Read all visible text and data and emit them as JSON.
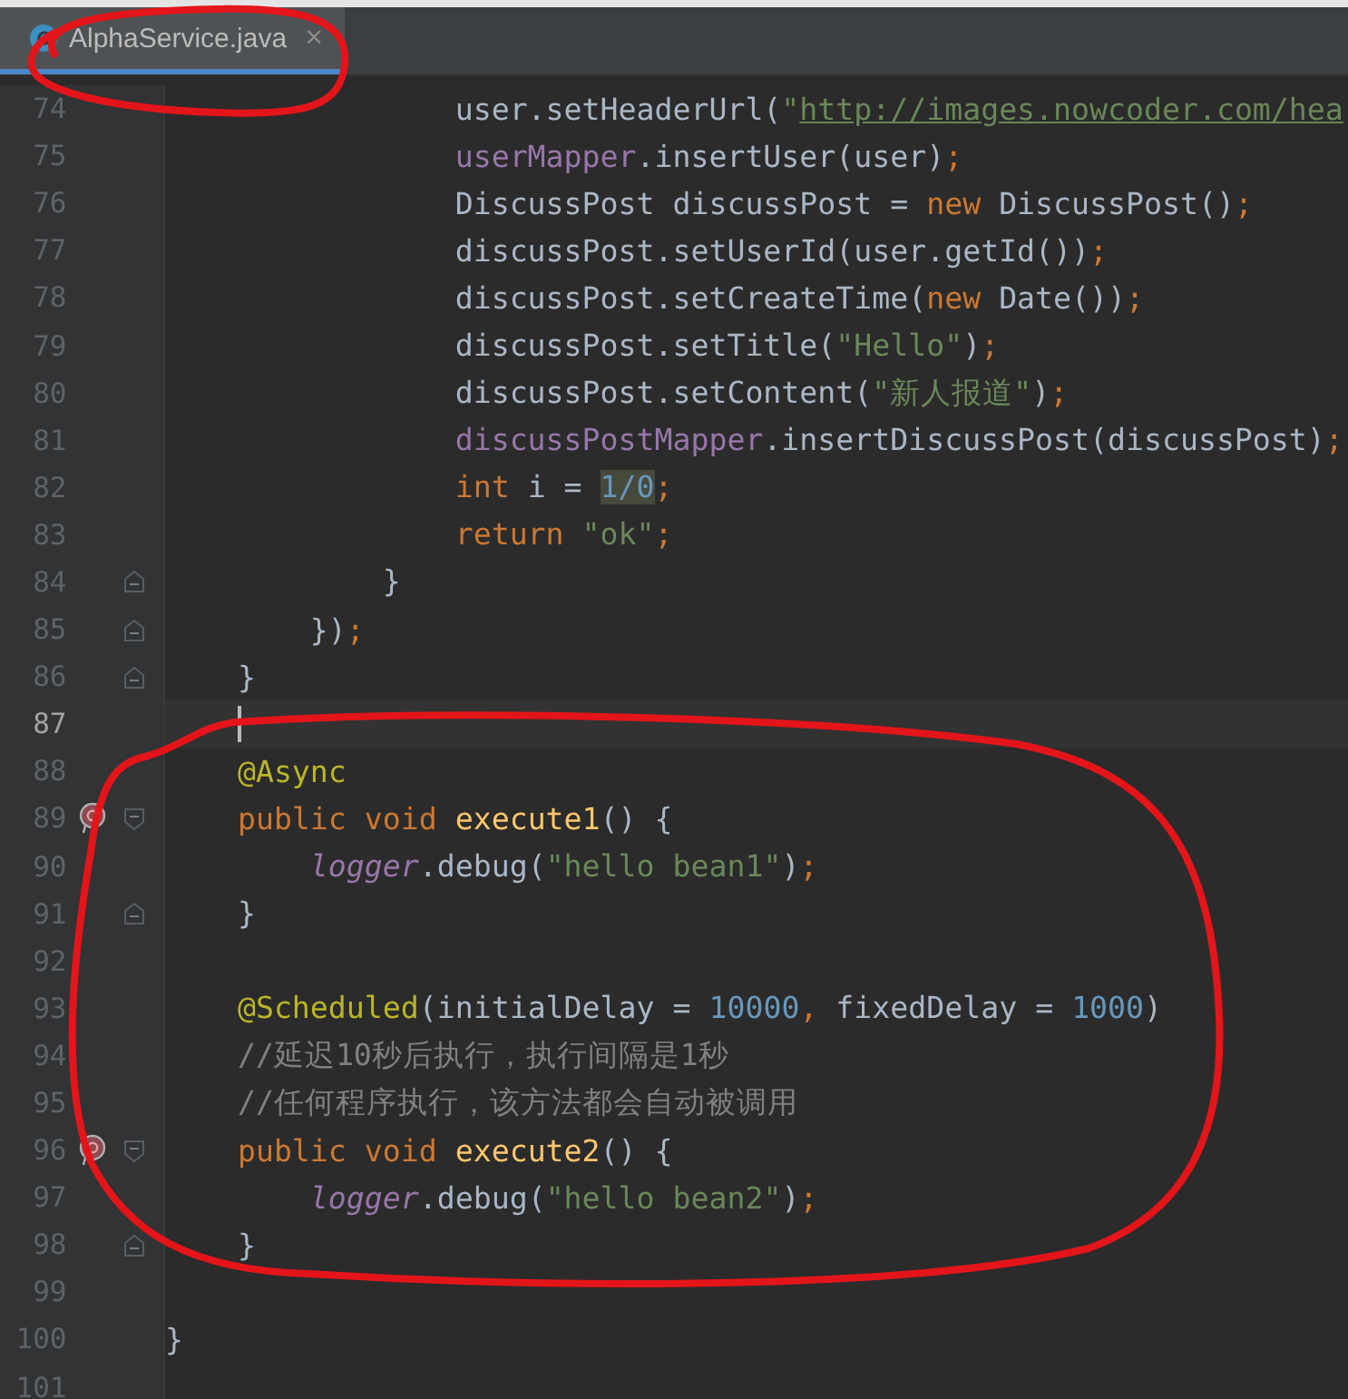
{
  "tab": {
    "label": "AlphaService.java",
    "close": "×",
    "selected": true
  },
  "lines": [
    {
      "number": "74",
      "tokens": [
        {
          "kind": "plain",
          "text": "                user.setHeaderUrl("
        },
        {
          "kind": "string",
          "text": "\""
        },
        {
          "kind": "url",
          "text": "http://images.nowcoder.com/hea"
        }
      ]
    },
    {
      "number": "75",
      "tokens": [
        {
          "kind": "field",
          "text": "                userMapper"
        },
        {
          "kind": "plain",
          "text": ".insertUser(user)"
        },
        {
          "kind": "punct",
          "text": ";"
        }
      ]
    },
    {
      "number": "76",
      "tokens": [
        {
          "kind": "plain",
          "text": "                DiscussPost discussPost = "
        },
        {
          "kind": "keyword",
          "text": "new"
        },
        {
          "kind": "plain",
          "text": " DiscussPost()"
        },
        {
          "kind": "punct",
          "text": ";"
        }
      ]
    },
    {
      "number": "77",
      "tokens": [
        {
          "kind": "plain",
          "text": "                discussPost.setUserId(user.getId())"
        },
        {
          "kind": "punct",
          "text": ";"
        }
      ]
    },
    {
      "number": "78",
      "tokens": [
        {
          "kind": "plain",
          "text": "                discussPost.setCreateTime("
        },
        {
          "kind": "keyword",
          "text": "new"
        },
        {
          "kind": "plain",
          "text": " Date())"
        },
        {
          "kind": "punct",
          "text": ";"
        }
      ]
    },
    {
      "number": "79",
      "tokens": [
        {
          "kind": "plain",
          "text": "                discussPost.setTitle("
        },
        {
          "kind": "string",
          "text": "\"Hello\""
        },
        {
          "kind": "plain",
          "text": ")"
        },
        {
          "kind": "punct",
          "text": ";"
        }
      ]
    },
    {
      "number": "80",
      "tokens": [
        {
          "kind": "plain",
          "text": "                discussPost.setContent("
        },
        {
          "kind": "string",
          "text": "\"新人报道\""
        },
        {
          "kind": "plain",
          "text": ")"
        },
        {
          "kind": "punct",
          "text": ";"
        }
      ]
    },
    {
      "number": "81",
      "tokens": [
        {
          "kind": "field",
          "text": "                discussPostMapper"
        },
        {
          "kind": "plain",
          "text": ".insertDiscussPost(discussPost)"
        },
        {
          "kind": "punct",
          "text": ";"
        }
      ]
    },
    {
      "number": "82",
      "tokens": [
        {
          "kind": "keyword",
          "text": "                int"
        },
        {
          "kind": "plain",
          "text": " i = "
        },
        {
          "kind": "warning",
          "text": "1/0"
        },
        {
          "kind": "punct",
          "text": ";"
        }
      ]
    },
    {
      "number": "83",
      "tokens": [
        {
          "kind": "keyword",
          "text": "                return "
        },
        {
          "kind": "string",
          "text": "\"ok\""
        },
        {
          "kind": "punct",
          "text": ";"
        }
      ]
    },
    {
      "number": "84",
      "fold_end": true,
      "tokens": [
        {
          "kind": "plain",
          "text": "            }"
        }
      ]
    },
    {
      "number": "85",
      "fold_end": true,
      "tokens": [
        {
          "kind": "plain",
          "text": "        })"
        },
        {
          "kind": "punct",
          "text": ";"
        }
      ]
    },
    {
      "number": "86",
      "fold_end": true,
      "tokens": [
        {
          "kind": "plain",
          "text": "    }"
        }
      ]
    },
    {
      "number": "87",
      "current": true,
      "caret": true
    },
    {
      "number": "88",
      "tokens": [
        {
          "kind": "annotation",
          "text": "    @Async"
        }
      ]
    },
    {
      "number": "89",
      "method_marker": true,
      "fold_start": true,
      "tokens": [
        {
          "kind": "keyword",
          "text": "    public void "
        },
        {
          "kind": "method",
          "text": "execute1"
        },
        {
          "kind": "plain",
          "text": "() {"
        }
      ]
    },
    {
      "number": "90",
      "tokens": [
        {
          "kind": "static",
          "text": "        logger"
        },
        {
          "kind": "plain",
          "text": ".debug("
        },
        {
          "kind": "string",
          "text": "\"hello bean1\""
        },
        {
          "kind": "plain",
          "text": ")"
        },
        {
          "kind": "punct",
          "text": ";"
        }
      ]
    },
    {
      "number": "91",
      "fold_end": true,
      "tokens": [
        {
          "kind": "plain",
          "text": "    }"
        }
      ]
    },
    {
      "number": "92"
    },
    {
      "number": "93",
      "tokens": [
        {
          "kind": "annotation",
          "text": "    @Scheduled"
        },
        {
          "kind": "plain",
          "text": "(initialDelay = "
        },
        {
          "kind": "number",
          "text": "10000"
        },
        {
          "kind": "punct",
          "text": ","
        },
        {
          "kind": "plain",
          "text": " fixedDelay = "
        },
        {
          "kind": "number",
          "text": "1000"
        },
        {
          "kind": "plain",
          "text": ")"
        }
      ]
    },
    {
      "number": "94",
      "tokens": [
        {
          "kind": "comment",
          "text": "    //延迟10秒后执行，执行间隔是1秒"
        }
      ]
    },
    {
      "number": "95",
      "tokens": [
        {
          "kind": "comment",
          "text": "    //任何程序执行，该方法都会自动被调用"
        }
      ]
    },
    {
      "number": "96",
      "method_marker": true,
      "fold_start": true,
      "tokens": [
        {
          "kind": "keyword",
          "text": "    public void "
        },
        {
          "kind": "method",
          "text": "execute2"
        },
        {
          "kind": "plain",
          "text": "() {"
        }
      ]
    },
    {
      "number": "97",
      "tokens": [
        {
          "kind": "static",
          "text": "        logger"
        },
        {
          "kind": "plain",
          "text": ".debug("
        },
        {
          "kind": "string",
          "text": "\"hello bean2\""
        },
        {
          "kind": "plain",
          "text": ")"
        },
        {
          "kind": "punct",
          "text": ";"
        }
      ]
    },
    {
      "number": "98",
      "fold_end": true,
      "tokens": [
        {
          "kind": "plain",
          "text": "    }"
        }
      ]
    },
    {
      "number": "99"
    },
    {
      "number": "100",
      "tokens": [
        {
          "kind": "plain",
          "text": "}"
        }
      ]
    },
    {
      "number": "101"
    }
  ]
}
